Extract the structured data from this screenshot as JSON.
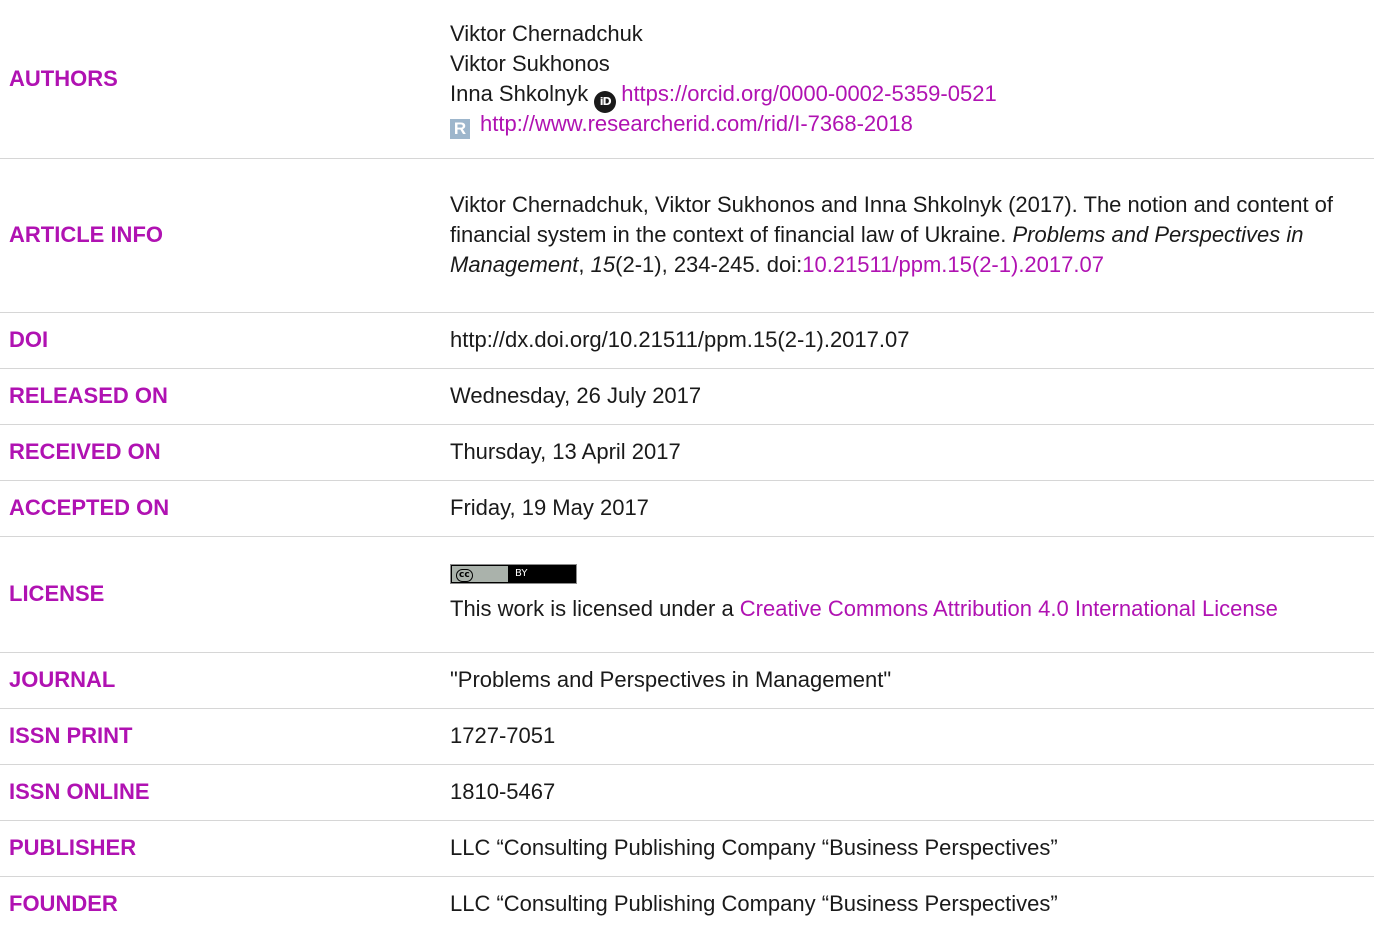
{
  "labels": {
    "authors": "AUTHORS",
    "article_info": "ARTICLE INFO",
    "doi": "DOI",
    "released_on": "RELEASED ON",
    "received_on": "RECEIVED ON",
    "accepted_on": "ACCEPTED ON",
    "license": "LICENSE",
    "journal": "JOURNAL",
    "issn_print": "ISSN PRINT",
    "issn_online": "ISSN ONLINE",
    "publisher": "PUBLISHER",
    "founder": "FOUNDER"
  },
  "authors": {
    "author1": "Viktor Chernadchuk",
    "author2": "Viktor Sukhonos",
    "author3": "Inna Shkolnyk",
    "orcid_icon_text": "iD",
    "orcid_url": "https://orcid.org/0000-0002-5359-0521",
    "rid_icon_text": "R",
    "researcherid_url": "http://www.researcherid.com/rid/I-7368-2018"
  },
  "article_info": {
    "citation_start": "Viktor Chernadchuk, Viktor Sukhonos and Inna Shkolnyk (2017). The notion and content of financial system in the context of financial law of Ukraine. ",
    "journal_name": "Problems and Perspectives in Management",
    "comma1": ", ",
    "volume": "15",
    "pages": "(2-1), 234-245. doi:",
    "doi_link": "10.21511/ppm.15(2-1).2017.07"
  },
  "doi": "http://dx.doi.org/10.21511/ppm.15(2-1).2017.07",
  "released_on": "Wednesday, 26 July 2017",
  "received_on": "Thursday, 13 April 2017",
  "accepted_on": "Friday, 19 May 2017",
  "license": {
    "badge_left": "cc",
    "badge_right": "BY",
    "text_prefix": "This work is licensed under a ",
    "link_text": "Creative Commons Attribution 4.0 International License"
  },
  "journal": "\"Problems and Perspectives in Management\"",
  "issn_print": "1727-7051",
  "issn_online": "1810-5467",
  "publisher": "LLC “Consulting Publishing Company “Business Perspectives”",
  "founder": "LLC “Consulting Publishing Company “Business Perspectives”",
  "colors": {
    "accent": "#b012b2",
    "text": "#1a1a1a",
    "divider": "#d6d6d6"
  }
}
